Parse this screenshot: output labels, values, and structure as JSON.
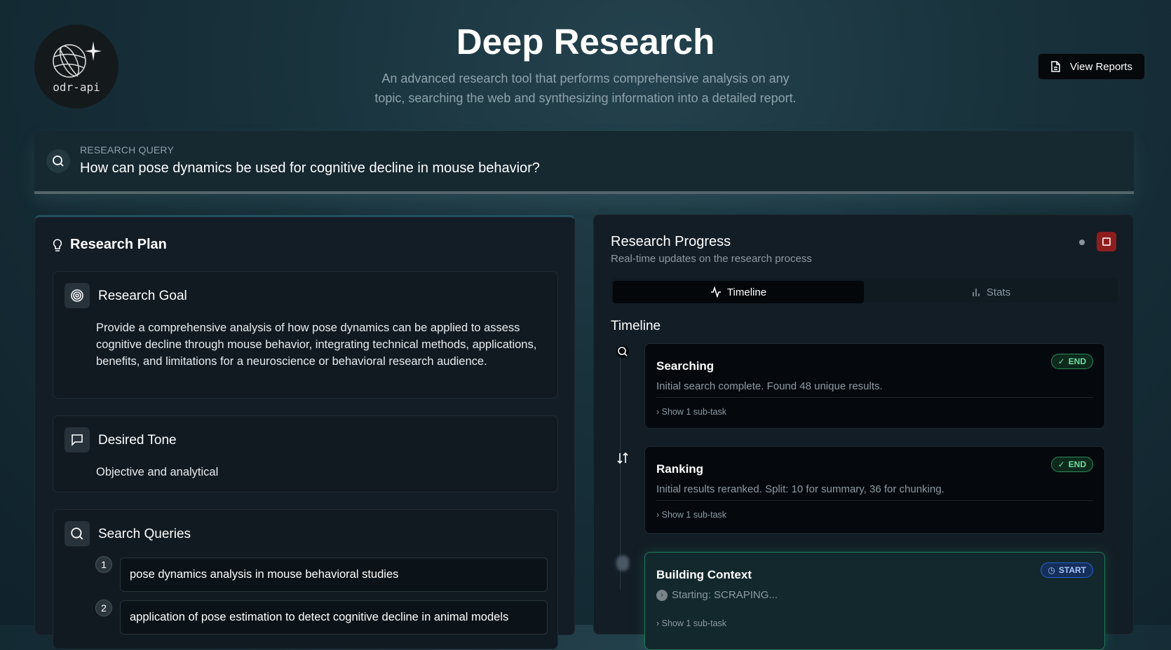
{
  "logo": {
    "text": "odr-api"
  },
  "header": {
    "title": "Deep Research",
    "subtitle_line1": "An advanced research tool that performs comprehensive analysis on any",
    "subtitle_line2": "topic, searching the web and synthesizing information into a detailed report.",
    "view_reports": "View Reports"
  },
  "query": {
    "label": "RESEARCH QUERY",
    "value": "How can pose dynamics be used for cognitive decline in mouse behavior?"
  },
  "plan": {
    "title": "Research Plan",
    "goal": {
      "title": "Research Goal",
      "text": "Provide a comprehensive analysis of how pose dynamics can be applied to assess cognitive decline through mouse behavior, integrating technical methods, applications, benefits, and limitations for a neuroscience or behavioral research audience."
    },
    "tone": {
      "title": "Desired Tone",
      "text": "Objective and analytical"
    },
    "queries": {
      "title": "Search Queries",
      "items": [
        {
          "n": "1",
          "text": "pose dynamics analysis in mouse behavioral studies"
        },
        {
          "n": "2",
          "text": "application of pose estimation to detect cognitive decline in animal models"
        }
      ]
    }
  },
  "progress": {
    "title": "Research Progress",
    "subtitle": "Real-time updates on the research process",
    "tabs": [
      "Timeline",
      "Stats"
    ],
    "timeline_heading": "Timeline",
    "events": [
      {
        "title": "Searching",
        "desc": "Initial search complete. Found 48 unique results.",
        "badge": "END",
        "subtask": "Show 1 sub-task"
      },
      {
        "title": "Ranking",
        "desc": "Initial results reranked. Split: 10 for summary, 36 for chunking.",
        "badge": "END",
        "subtask": "Show 1 sub-task"
      },
      {
        "title": "Building Context",
        "desc": "Starting: SCRAPING...",
        "badge": "START",
        "subtask": "Show 1 sub-task"
      }
    ]
  },
  "colors": {
    "stop": "#8e1e1e",
    "end": "#6ee0a0",
    "start": "#a8c6ff"
  }
}
